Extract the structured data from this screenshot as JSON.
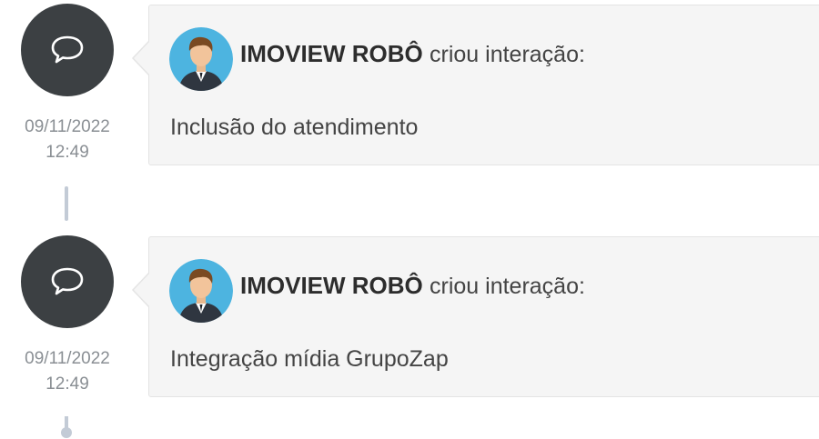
{
  "timeline": {
    "entries": [
      {
        "icon": "chat-bubble-icon",
        "date": "09/11/2022",
        "time": "12:49",
        "author": "IMOVIEW ROBÔ",
        "action": "criou interação:",
        "text": "Inclusão do atendimento"
      },
      {
        "icon": "chat-bubble-icon",
        "date": "09/11/2022",
        "time": "12:49",
        "author": "IMOVIEW ROBÔ",
        "action": "criou interação:",
        "text": "Integração mídia GrupoZap"
      }
    ]
  },
  "colors": {
    "icon_circle": "#3c4043",
    "card_bg": "#f5f5f5",
    "connector": "#c3cbd6",
    "date_text": "#8a8f94"
  }
}
